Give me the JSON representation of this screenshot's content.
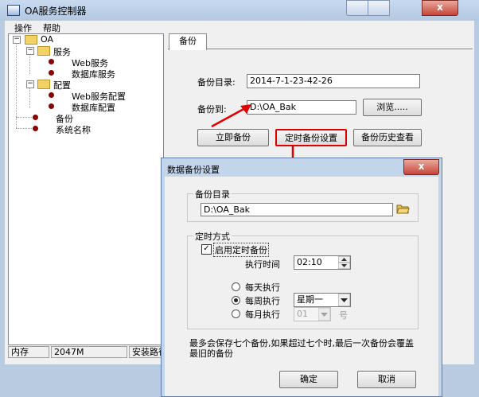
{
  "window": {
    "title": "OA服务控制器",
    "close_glyph": "x"
  },
  "menu": [
    "操作",
    "帮助"
  ],
  "tree": {
    "root": "OA",
    "service": "服务",
    "web_service": "Web服务",
    "db_service": "数据库服务",
    "config": "配置",
    "web_config": "Web服务配置",
    "db_config": "数据库配置",
    "backup": "备份",
    "system_name": "系统名称"
  },
  "status": {
    "mem_label": "内存",
    "mem_value": "2047M",
    "install_path": "安装路径"
  },
  "tab": {
    "label": "备份"
  },
  "backup": {
    "dir_label": "备份目录:",
    "dir_value": "2014-7-1-23-42-26",
    "to_label": "备份到:",
    "to_value": "D:\\OA_Bak",
    "browse": "浏览.....",
    "now": "立即备份",
    "schedule": "定时备份设置",
    "history": "备份历史查看"
  },
  "dialog": {
    "title": "数据备份设置",
    "close_glyph": "x",
    "dir_group": "备份目录",
    "dir_value": "D:\\OA_Bak",
    "mode_group": "定时方式",
    "enable_label": "启用定时备份",
    "enable_checked": true,
    "exec_time_label": "执行时间",
    "exec_time_value": "02:10",
    "daily": "每天执行",
    "weekly": "每周执行",
    "weekly_value": "星期一",
    "monthly": "每月执行",
    "monthly_value": "01",
    "day_unit": "号",
    "selected": "weekly",
    "note": "最多会保存七个备份,如果超过七个时,最后一次备份会覆盖最旧的备份",
    "ok": "确定",
    "cancel": "取消"
  }
}
